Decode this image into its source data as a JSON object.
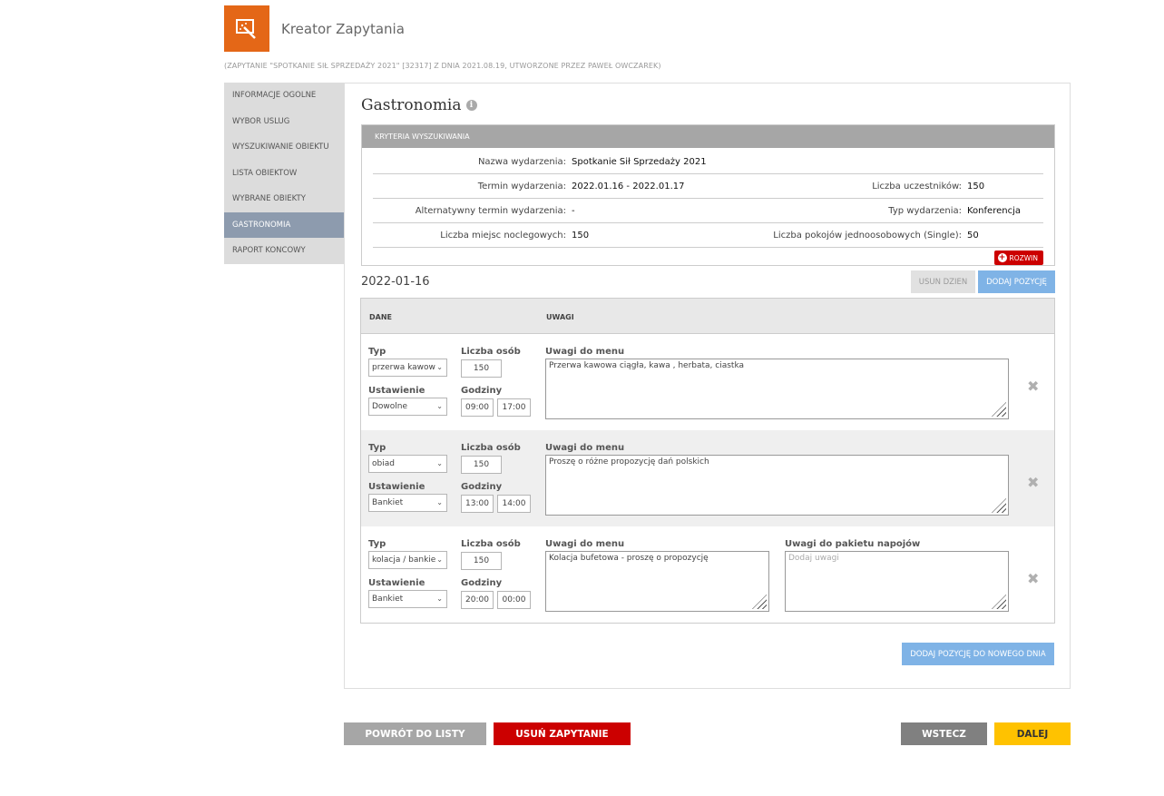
{
  "header": {
    "title": "Kreator Zapytania",
    "subtitle": "(ZAPYTANIE \"SPOTKANIE SIŁ SPRZEDAŻY 2021\" [32317] Z DNIA 2021.08.19, UTWORZONE PRZEZ PAWEŁ OWCZAREK)",
    "logo_icon": "magic-wand-icon",
    "logo_color": "#e46717"
  },
  "sidebar": {
    "items": [
      {
        "label": "INFORMACJE OGOLNE"
      },
      {
        "label": "WYBOR USLUG"
      },
      {
        "label": "WYSZUKIWANIE OBIEKTU"
      },
      {
        "label": "LISTA OBIEKTOW"
      },
      {
        "label": "WYBRANE OBIEKTY"
      },
      {
        "label": "GASTRONOMIA",
        "active": true
      },
      {
        "label": "RAPORT KONCOWY"
      }
    ]
  },
  "main": {
    "title": "Gastronomia",
    "criteria": {
      "heading": "KRYTERIA WYSZUKIWANIA",
      "rows": [
        {
          "label1": "Nazwa wydarzenia:",
          "value1": "Spotkanie Sił Sprzedaży 2021",
          "label2": "",
          "value2": ""
        },
        {
          "label1": "Termin wydarzenia:",
          "value1": "2022.01.16 - 2022.01.17",
          "label2": "Liczba uczestników:",
          "value2": "150"
        },
        {
          "label1": "Alternatywny termin wydarzenia:",
          "value1": "-",
          "label2": "Typ wydarzenia:",
          "value2": "Konferencja"
        },
        {
          "label1": "Liczba miejsc noclegowych:",
          "value1": "150",
          "label2": "Liczba pokojów jednoosobowych (Single):",
          "value2": "50"
        }
      ],
      "expand_label": "ROZWIN"
    },
    "day": {
      "date": "2022-01-16",
      "remove_day_label": "USUN DZIEN",
      "add_item_label": "DODAJ POZYCJĘ",
      "columns": {
        "dane": "DANE",
        "uwagi": "UWAGI"
      },
      "field_labels": {
        "typ": "Typ",
        "liczba_osob": "Liczba osób",
        "ustawienie": "Ustawienie",
        "godziny": "Godziny",
        "uwagi_menu": "Uwagi do menu",
        "uwagi_napoje": "Uwagi do pakietu napojów"
      },
      "items": [
        {
          "typ": "przerwa kawow",
          "liczba": "150",
          "ustawienie": "Dowolne",
          "od": "09:00",
          "do": "17:00",
          "uwagi_menu": "Przerwa kawowa ciągła, kawa , herbata, ciastka"
        },
        {
          "typ": "obiad",
          "liczba": "150",
          "ustawienie": "Bankiet",
          "od": "13:00",
          "do": "14:00",
          "uwagi_menu": "Proszę o różne propozycję dań polskich"
        },
        {
          "typ": "kolacja / bankie",
          "liczba": "150",
          "ustawienie": "Bankiet",
          "od": "20:00",
          "do": "00:00",
          "uwagi_menu": "Kolacja bufetowa - proszę o propozycję",
          "uwagi_napoje_placeholder": "Dodaj uwagi"
        }
      ]
    },
    "add_new_day_label": "DODAJ POZYCJĘ DO NOWEGO DNIA"
  },
  "footer": {
    "back_to_list": "POWRÓT DO LISTY",
    "delete_request": "USUŃ ZAPYTANIE",
    "back": "WSTECZ",
    "next": "DALEJ"
  },
  "colors": {
    "orange": "#e46717",
    "active_nav": "#8d9bae",
    "blue_btn": "#7fb3e6",
    "red_btn": "#cc0000",
    "grey_btn": "#a6a6a6",
    "dark_grey_btn": "#808080",
    "yellow_btn": "#ffc200"
  }
}
